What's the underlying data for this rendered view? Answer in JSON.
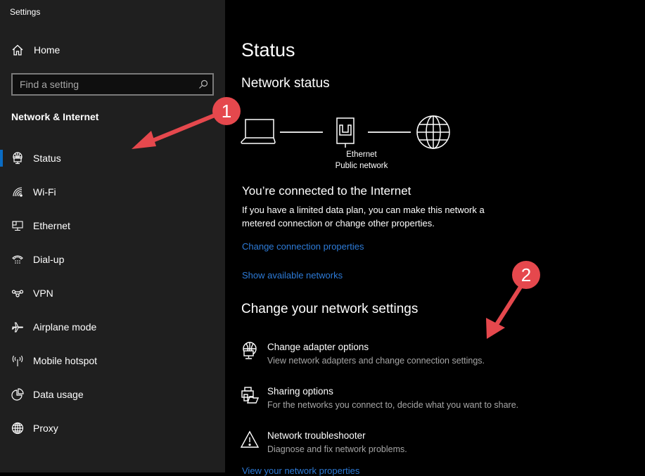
{
  "window": {
    "title": "Settings"
  },
  "sidebar": {
    "home_label": "Home",
    "search_placeholder": "Find a setting",
    "section_title": "Network & Internet",
    "selected": "Status",
    "accent_color": "#0a6cc4",
    "items": [
      {
        "label": "Status",
        "icon": "globe-monitor-icon"
      },
      {
        "label": "Wi-Fi",
        "icon": "wifi-icon"
      },
      {
        "label": "Ethernet",
        "icon": "ethernet-icon"
      },
      {
        "label": "Dial-up",
        "icon": "dial-up-phone-icon"
      },
      {
        "label": "VPN",
        "icon": "vpn-icon"
      },
      {
        "label": "Airplane mode",
        "icon": "airplane-icon"
      },
      {
        "label": "Mobile hotspot",
        "icon": "hotspot-icon"
      },
      {
        "label": "Data usage",
        "icon": "pie-chart-icon"
      },
      {
        "label": "Proxy",
        "icon": "globe-icon"
      }
    ]
  },
  "main": {
    "page_title": "Status",
    "network_status_heading": "Network status",
    "diagram": {
      "connection_label": "Ethernet",
      "network_type": "Public network"
    },
    "connected_heading": "You’re connected to the Internet",
    "connected_description": "If you have a limited data plan, you can make this network a metered connection or change other properties.",
    "links": {
      "change_connection_properties": "Change connection properties",
      "show_available_networks": "Show available networks",
      "view_network_properties": "View your network properties"
    },
    "change_settings_heading": "Change your network settings",
    "options": [
      {
        "title": "Change adapter options",
        "subtitle": "View network adapters and change connection settings.",
        "icon": "adapter-globe-icon"
      },
      {
        "title": "Sharing options",
        "subtitle": "For the networks you connect to, decide what you want to share.",
        "icon": "sharing-icon"
      },
      {
        "title": "Network troubleshooter",
        "subtitle": "Diagnose and fix network problems.",
        "icon": "warning-icon"
      }
    ],
    "link_color": "#2d7bd8"
  },
  "annotations": [
    {
      "number": "1",
      "color": "#e5484d"
    },
    {
      "number": "2",
      "color": "#e5484d"
    }
  ]
}
